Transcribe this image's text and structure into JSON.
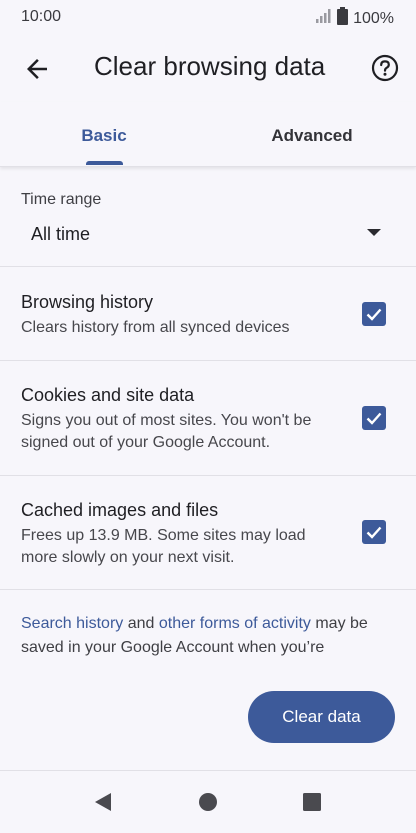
{
  "status_bar": {
    "time": "10:00",
    "battery": "100%"
  },
  "header": {
    "title": "Clear browsing data",
    "back_icon": "arrow-back-icon",
    "help_icon": "help-icon"
  },
  "tabs": [
    {
      "label": "Basic",
      "selected": true
    },
    {
      "label": "Advanced",
      "selected": false
    }
  ],
  "time_range": {
    "label": "Time range",
    "value": "All time"
  },
  "options": [
    {
      "title": "Browsing history",
      "desc": "Clears history from all synced devices",
      "checked": true
    },
    {
      "title": "Cookies and site data",
      "desc": "Signs you out of most sites. You won't be signed out of your Google Account.",
      "checked": true
    },
    {
      "title": "Cached images and files",
      "desc": "Frees up 13.9 MB. Some sites may load more slowly on your next visit.",
      "checked": true
    }
  ],
  "footer": {
    "link1": "Search history",
    "text1": " and ",
    "link2": "other forms of activity",
    "text2": " may be saved in your Google Account when you’re"
  },
  "clear_button": "Clear data",
  "colors": {
    "accent": "#3d5a9a",
    "background": "#f7f6fb",
    "divider": "#e1e0e6"
  }
}
